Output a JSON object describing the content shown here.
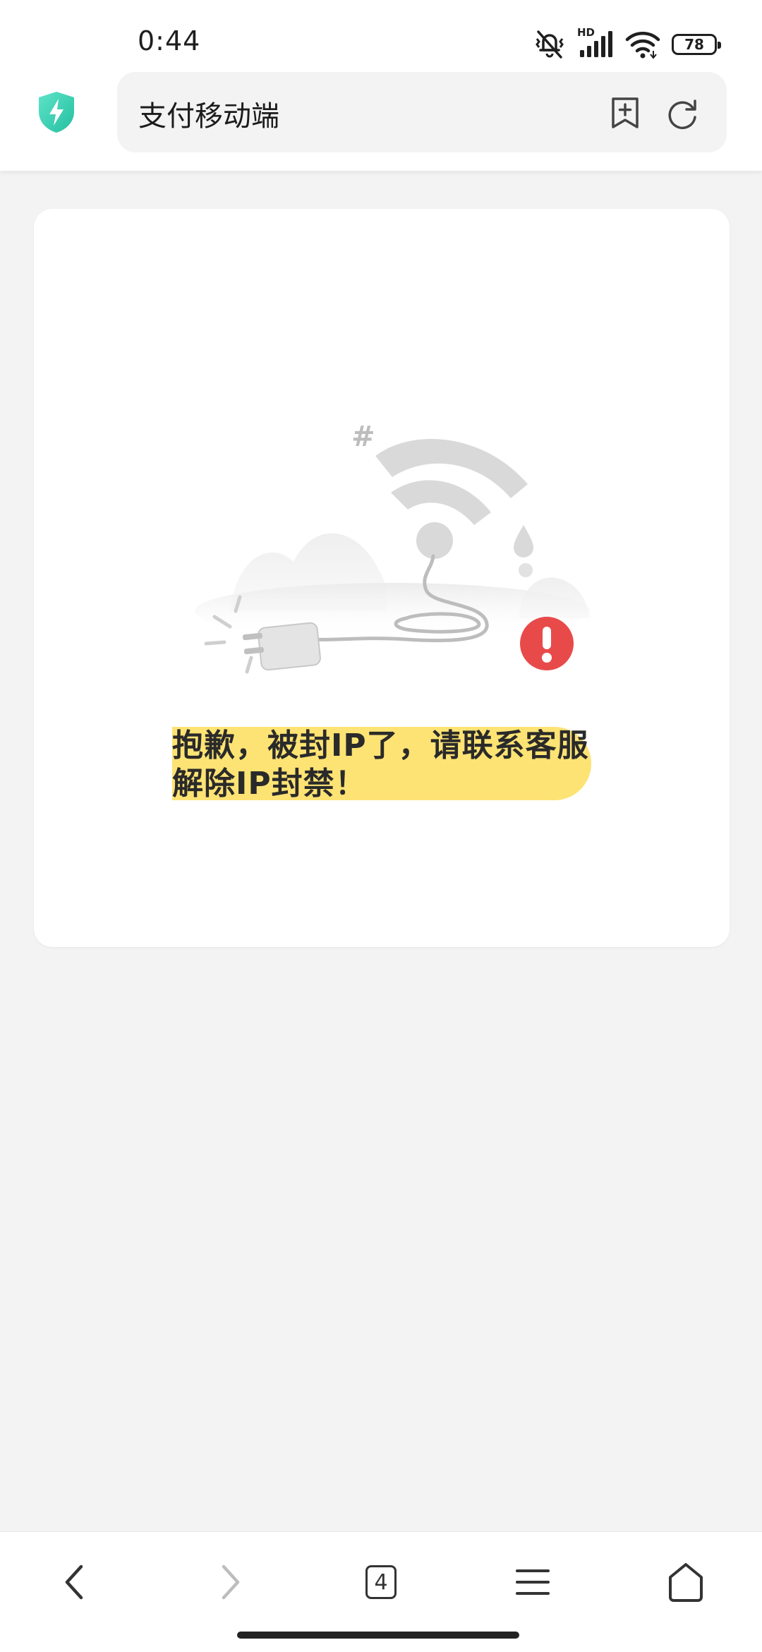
{
  "status_bar": {
    "time": "0:44",
    "network_badge": "HD",
    "battery_level": "78",
    "icons": [
      "mute-icon",
      "signal-icon",
      "wifi-icon",
      "battery-icon"
    ]
  },
  "address_bar": {
    "title": "支付移动端",
    "security_icon": "shield-lightning-icon",
    "actions": [
      "bookmark-add-icon",
      "refresh-icon"
    ]
  },
  "error_card": {
    "illustration": "disconnected-wifi-plug-illustration",
    "illustration_symbol": "#",
    "message": "抱歉，被封IP了，请联系客服解除IP封禁！"
  },
  "bottom_nav": {
    "tab_count": "4",
    "icons": [
      "back-icon",
      "forward-icon",
      "tabs-icon",
      "menu-icon",
      "home-icon"
    ]
  },
  "colors": {
    "background": "#f3f3f3",
    "highlight": "#fde374",
    "alert_red": "#e84a4a",
    "shield_teal": "#3dd6b8"
  }
}
